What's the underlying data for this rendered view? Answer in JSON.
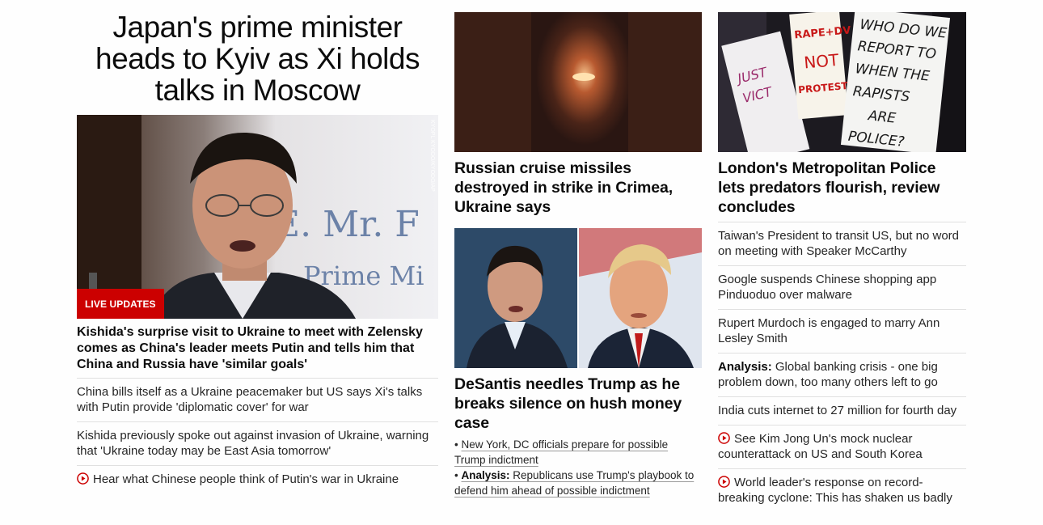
{
  "left": {
    "headline": "Japan's prime minister heads to Kyiv as Xi holds talks in Moscow",
    "hero_badge": "LIVE UPDATES",
    "hero_credit": "KYOPL KYODO/KYODO/AP",
    "hero_backdrop_text": ".E. Mr. F",
    "hero_backdrop_text2": "Prime Mi",
    "lead": "Kishida's surprise visit to Ukraine to meet with Zelensky comes as China's leader meets Putin and tells him that China and Russia have 'similar goals'",
    "links": [
      "China bills itself as a Ukraine peacemaker but US says Xi's talks with Putin provide 'diplomatic cover' for war",
      "Kishida previously spoke out against invasion of Ukraine, warning that 'Ukraine today may be East Asia tomorrow'",
      "Hear what Chinese people think of Putin's war in Ukraine"
    ]
  },
  "middle": {
    "card1_title": "Russian cruise missiles destroyed in strike in Crimea, Ukraine says",
    "card2_title": "DeSantis needles Trump as he breaks silence on hush money case",
    "card2_links": [
      {
        "prefix": "•",
        "bold": "",
        "text": "New York, DC officials prepare for possible Trump indictment"
      },
      {
        "prefix": "•",
        "bold": "Analysis:",
        "text": "Republicans use Trump's playbook to defend him ahead of possible indictment"
      }
    ]
  },
  "right": {
    "card_title": "London's Metropolitan Police lets predators flourish, review concludes",
    "protest_signs": [
      "WHO DO WE",
      "REPORT TO",
      "WHEN THE",
      "RAPISTS",
      "ARE",
      "POLICE?"
    ],
    "protest_signs2": [
      "RAPE+DV",
      "NOT",
      "PROTEST"
    ],
    "links": [
      {
        "bold": "",
        "text": "Taiwan's President to transit US, but no word on meeting with Speaker McCarthy"
      },
      {
        "bold": "",
        "text": "Google suspends Chinese shopping app Pinduoduo over malware"
      },
      {
        "bold": "",
        "text": "Rupert Murdoch is engaged to marry Ann Lesley Smith"
      },
      {
        "bold": "Analysis:",
        "text": "Global banking crisis - one big problem down, too many others left to go"
      },
      {
        "bold": "",
        "text": "India cuts internet to 27 million for fourth day"
      },
      {
        "bold": "",
        "text": "See Kim Jong Un's mock nuclear counterattack on US and South Korea"
      },
      {
        "bold": "",
        "text": "World leader's response on record-breaking cyclone: This has shaken us badly"
      }
    ]
  },
  "colors": {
    "accent_red": "#cc0000",
    "divider": "#e0e0e0",
    "text": "#0c0c0c"
  },
  "icons": {
    "video": "play-circle-icon"
  }
}
